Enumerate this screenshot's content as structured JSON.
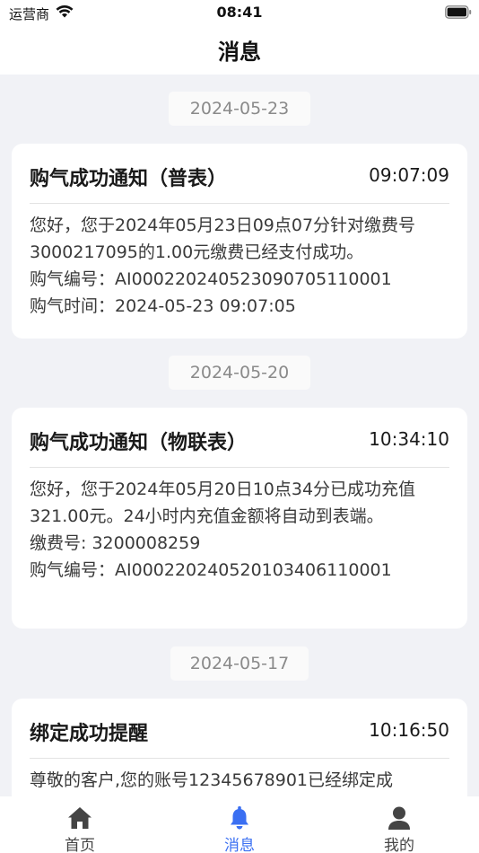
{
  "status_bar": {
    "carrier": "运营商",
    "time": "08:41"
  },
  "nav": {
    "title": "消息"
  },
  "messages": [
    {
      "date": "2024-05-23",
      "title": "购气成功通知（普表）",
      "time": "09:07:09",
      "lines": [
        "您好，您于2024年05月23日09点07分针对缴费号3000217095的1.00元缴费已经支付成功。",
        "购气编号：AI000220240523090705110001",
        "购气时间：2024-05-23 09:07:05"
      ]
    },
    {
      "date": "2024-05-20",
      "title": "购气成功通知（物联表）",
      "time": "10:34:10",
      "lines": [
        "您好，您于2024年05月20日10点34分已成功充值321.00元。24小时内充值金额将自动到表端。",
        "缴费号: 3200008259",
        "购气编号：AI000220240520103406110001"
      ]
    },
    {
      "date": "2024-05-17",
      "title": "绑定成功提醒",
      "time": "10:16:50",
      "lines": [
        "尊敬的客户,您的账号12345678901已经绑定成"
      ]
    }
  ],
  "tabs": [
    {
      "label": "首页",
      "icon": "home-icon",
      "active": false
    },
    {
      "label": "消息",
      "icon": "bell-icon",
      "active": true
    },
    {
      "label": "我的",
      "icon": "user-icon",
      "active": false
    }
  ],
  "colors": {
    "accent": "#3a6ff2",
    "background": "#f1f2f6",
    "card": "#ffffff",
    "muted_text": "#8a8a8a"
  }
}
